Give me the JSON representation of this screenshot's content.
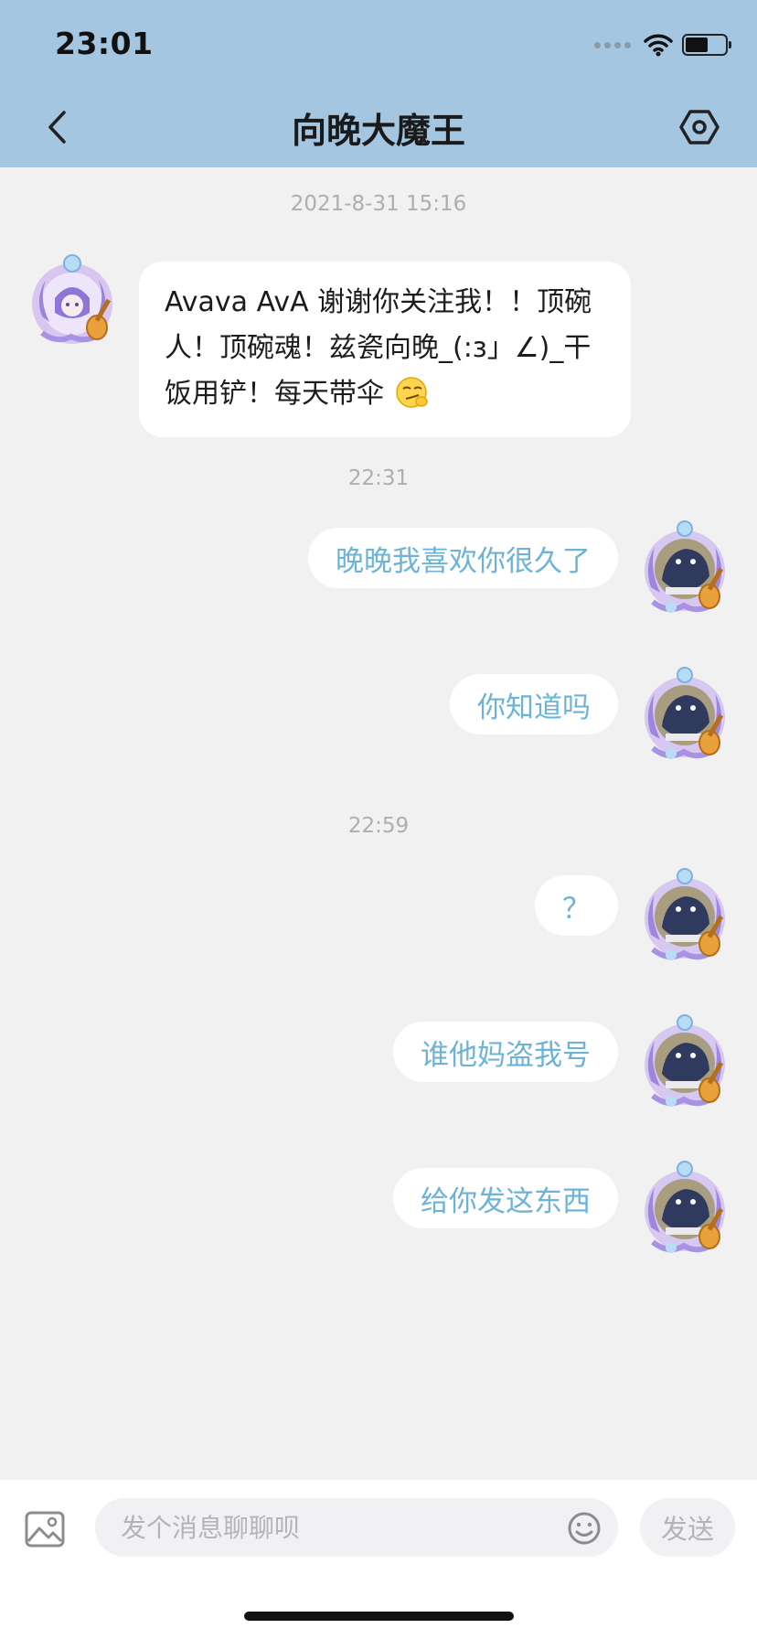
{
  "status_bar": {
    "time": "23:01"
  },
  "header": {
    "title": "向晚大魔王"
  },
  "messages": [
    {
      "timestamp": "2021-8-31 15:16",
      "incoming_text": "Avava AvA 谢谢你关注我！！顶碗人！顶碗魂！兹瓷向晚_(:з」∠)_干饭用铲！每天带伞",
      "emoji": "smirk-emoji"
    },
    {
      "timestamp": "22:31"
    },
    {
      "outgoing_text": "晚晚我喜欢你很久了"
    },
    {
      "outgoing_text": "你知道吗"
    },
    {
      "timestamp": "22:59"
    },
    {
      "outgoing_text": "？"
    },
    {
      "outgoing_text": "谁他妈盗我号"
    },
    {
      "outgoing_text": "给你发这东西"
    }
  ],
  "input": {
    "placeholder": "发个消息聊聊呗",
    "value": ""
  },
  "send_label": "发送",
  "colors": {
    "header_bg": "#a4c6e0",
    "outgoing_text": "#6cb3d6",
    "chat_bg": "#f1f1f2"
  }
}
